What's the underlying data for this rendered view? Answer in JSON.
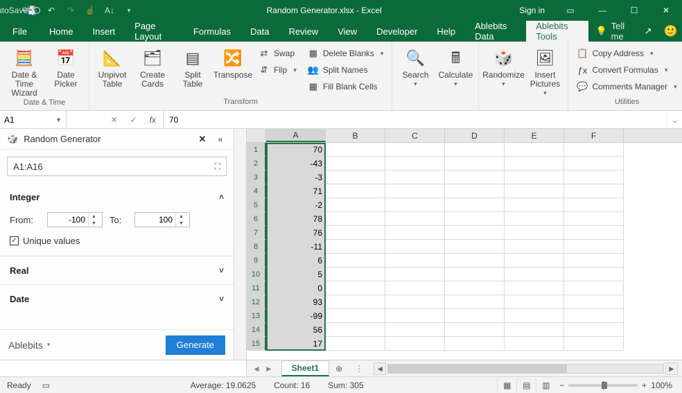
{
  "titlebar": {
    "autosave_label": "AutoSave",
    "autosave_state": "Off",
    "title": "Random Generator.xlsx - Excel",
    "signin": "Sign in"
  },
  "tabs": {
    "file": "File",
    "items": [
      "Home",
      "Insert",
      "Page Layout",
      "Formulas",
      "Data",
      "Review",
      "View",
      "Developer",
      "Help",
      "Ablebits Data",
      "Ablebits Tools"
    ],
    "active": "Ablebits Tools",
    "tell": "Tell me"
  },
  "ribbon": {
    "groups": {
      "datetime": {
        "label": "Date & Time",
        "datetime_wizard": "Date & Time Wizard",
        "date_picker": "Date Picker"
      },
      "transform": {
        "label": "Transform",
        "unpivot": "Unpivot Table",
        "create_cards": "Create Cards",
        "split_table": "Split Table",
        "transpose": "Transpose",
        "swap": "Swap",
        "flip": "Flip",
        "delete_blanks": "Delete Blanks",
        "split_names": "Split Names",
        "fill_blank": "Fill Blank Cells"
      },
      "mid": {
        "search": "Search",
        "calculate": "Calculate",
        "randomize": "Randomize",
        "insert_pictures": "Insert Pictures"
      },
      "utilities": {
        "label": "Utilities",
        "copy_address": "Copy Address",
        "convert_formulas": "Convert Formulas",
        "comments_manager": "Comments Manager"
      }
    }
  },
  "formula_bar": {
    "name": "A1",
    "value": "70"
  },
  "taskpane": {
    "title": "Random Generator",
    "range": "A1:A16",
    "integer": {
      "label": "Integer",
      "from_label": "From:",
      "from": "-100",
      "to_label": "To:",
      "to": "100",
      "unique": "Unique values",
      "unique_checked": true
    },
    "real": "Real",
    "date": "Date",
    "brand": "Ablebits",
    "generate": "Generate"
  },
  "grid": {
    "columns": [
      "A",
      "B",
      "C",
      "D",
      "E",
      "F"
    ],
    "row_count": 15,
    "selected_col": "A",
    "selected_rows": [
      1,
      15
    ],
    "values_A": [
      70,
      -43,
      -3,
      71,
      -2,
      78,
      76,
      -11,
      6,
      5,
      0,
      93,
      -99,
      56,
      17
    ]
  },
  "sheetbar": {
    "sheet": "Sheet1"
  },
  "status": {
    "ready": "Ready",
    "average_label": "Average:",
    "average": "19.0625",
    "count_label": "Count:",
    "count": "16",
    "sum_label": "Sum:",
    "sum": "305",
    "zoom": "100%"
  }
}
